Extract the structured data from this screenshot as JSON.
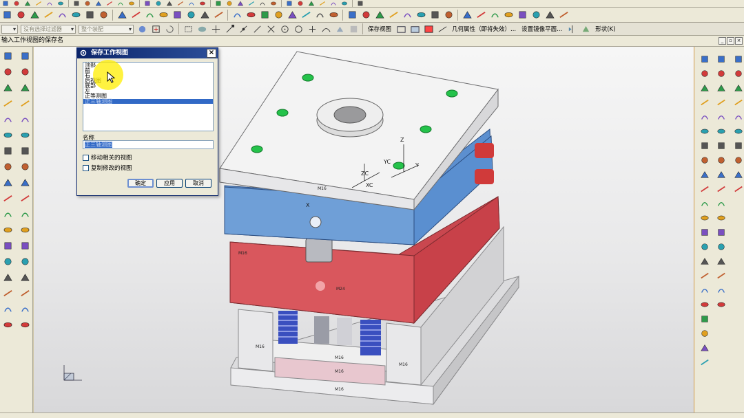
{
  "top_toolbar": {
    "mini_icons": [
      "file-icon",
      "save-icon",
      "cut-icon",
      "copy-icon",
      "paste-icon",
      "undo-icon",
      "redo-icon",
      "snap-icon",
      "point-icon",
      "line-icon",
      "arc-icon",
      "fillet-icon",
      "chamfer-icon",
      "mirror-icon",
      "offset-icon",
      "pattern-icon",
      "array-icon",
      "trim-icon",
      "extend-icon",
      "move-icon",
      "rotate-icon",
      "scale-icon",
      "layer-icon",
      "color-icon",
      "render-icon",
      "shade-icon",
      "grid-icon",
      "zoom-icon",
      "pan-icon",
      "fit-icon",
      "help-icon"
    ],
    "main_icons": [
      "table-icon",
      "sketch-icon",
      "pen-icon",
      "select-icon",
      "filter-icon",
      "snap-grid-icon",
      "axis-icon",
      "dimension-icon",
      "line-icon",
      "arc-icon",
      "rectangle-icon",
      "spline-icon",
      "text-icon",
      "gear-icon",
      "shape-icon",
      "box-icon",
      "cylinder-icon",
      "chamfer-icon",
      "blend-icon",
      "feature-icon",
      "sheet-icon",
      "extrude-icon",
      "revolve-icon",
      "sweep-icon",
      "shell-icon",
      "hole-icon",
      "boss-icon",
      "pocket-icon",
      "pad-icon",
      "slot-icon",
      "groove-icon",
      "rib-icon",
      "draft-icon",
      "thicken-icon",
      "trim-body-icon",
      "split-icon",
      "sew-icon",
      "patch-icon",
      "bridge-icon",
      "mold-icon"
    ]
  },
  "selection_bar": {
    "combo1": "没有选择过滤器",
    "combo2": "整个装配",
    "save_view_label": "保存视图",
    "geometry_props_label": "几何属性（即将失效）...",
    "mirror_plane_label": "设置镜像平面...",
    "shape_label": "形状(K)"
  },
  "cue_line": "输入工作视图的保存名",
  "dialog": {
    "title": "保存工作视图",
    "views": [
      "顶部",
      "前",
      "右",
      "后视图",
      "底部",
      "左",
      "正等测图",
      "正三轴测图"
    ],
    "selected_view_index": 7,
    "name_label": "名称",
    "name_value": "正三轴测图",
    "checkbox_move": "移动相关的视图",
    "checkbox_copy": "复制修改的视图",
    "ok_label": "确定",
    "apply_label": "应用",
    "cancel_label": "取消"
  },
  "model": {
    "bolt_labels": [
      "M24",
      "M16",
      "M16",
      "M16",
      "M16",
      "M16",
      "M16",
      "M16"
    ],
    "axis_labels": {
      "x": "X",
      "y": "Y",
      "z": "Z",
      "xc": "XC",
      "yc": "YC",
      "zc": "ZC"
    },
    "colors": {
      "top_plate": "#f3f3f3",
      "a_plate": "#6f9fd7",
      "b_plate": "#d9575d",
      "clamp_plate": "#e6e6e8",
      "spring": "#3a4fbf",
      "indicator_green": "#24c24a",
      "dialog_title": "#0a246a",
      "select": "#3169c6"
    }
  }
}
